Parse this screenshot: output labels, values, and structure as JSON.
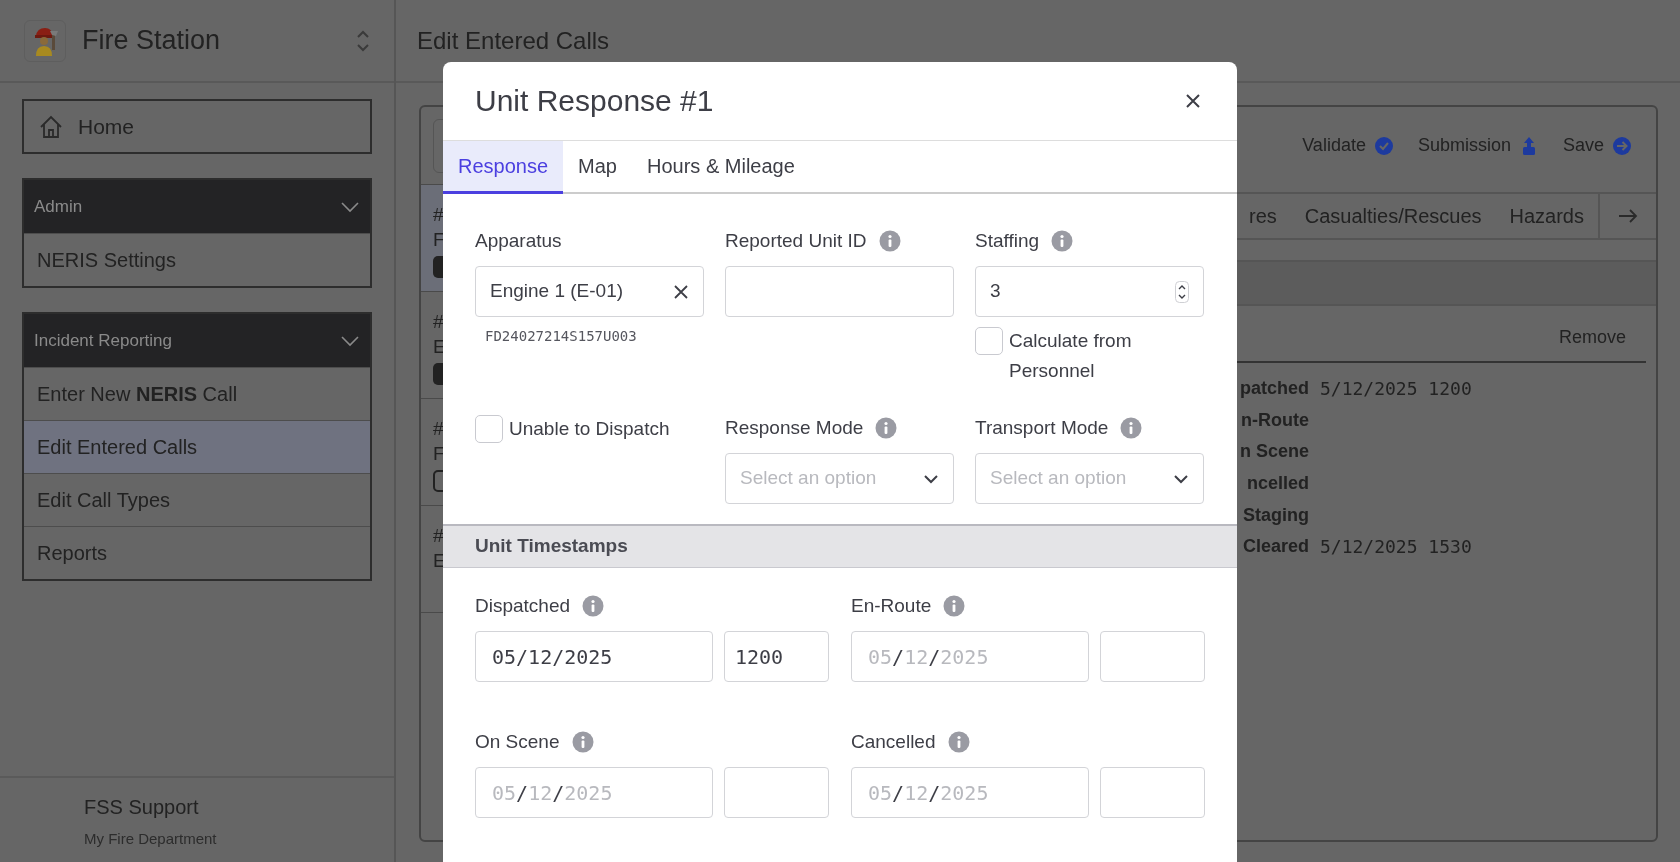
{
  "sidebar": {
    "brand": "Fire Station",
    "home": "Home",
    "groups": [
      {
        "title": "Admin",
        "expanded": true,
        "items": [
          {
            "label": "NERIS Settings",
            "selected": false
          }
        ]
      },
      {
        "title": "Incident Reporting",
        "expanded": true,
        "items": [
          {
            "label": "Enter New **NERIS** Call",
            "selected": false
          },
          {
            "label": "Edit Entered Calls",
            "selected": true
          },
          {
            "label": "Edit Call Types",
            "selected": false
          },
          {
            "label": "Reports",
            "selected": false
          }
        ]
      }
    ],
    "footer": {
      "name": "FSS Support",
      "org": "My Fire Department"
    }
  },
  "page": {
    "title": "Edit Entered Calls",
    "actions": [
      {
        "label": "Validate",
        "kind": "validate"
      },
      {
        "label": "Submission",
        "kind": "submit"
      },
      {
        "label": "Save",
        "kind": "save"
      }
    ],
    "calls": [
      {
        "number": "#",
        "type": "F",
        "badge": true,
        "badge_filled": true,
        "selected": true
      },
      {
        "number": "#",
        "type": "E",
        "badge": true,
        "badge_filled": true,
        "selected": false
      },
      {
        "number": "#",
        "type": "F",
        "badge": true,
        "badge_filled": false,
        "selected": false
      },
      {
        "number": "#",
        "type": "E",
        "badge": false,
        "selected": false
      }
    ],
    "tabs": [
      {
        "label": "res",
        "selected": false
      },
      {
        "label": "Casualties/Rescues",
        "selected": false
      },
      {
        "label": "Hazards",
        "selected": false
      }
    ],
    "remove": "Remove",
    "timestamps": [
      {
        "label": "patched",
        "value": "5/12/2025 1200"
      },
      {
        "label": "n-Route"
      },
      {
        "label": "n Scene"
      },
      {
        "label": "ncelled"
      },
      {
        "label": "Staging"
      },
      {
        "label": "Cleared",
        "value": "5/12/2025 1530"
      }
    ]
  },
  "modal": {
    "title": "Unit Response #1",
    "tabs": [
      {
        "label": "Response",
        "selected": true
      },
      {
        "label": "Map",
        "selected": false
      },
      {
        "label": "Hours & Mileage",
        "selected": false
      }
    ],
    "fields": [
      {
        "kind": "select",
        "label": "Apparatus",
        "value": "Engine 1 (E-01)",
        "clearable": true,
        "note": "FD24027214S157U003"
      },
      {
        "kind": "text",
        "label": "Reported Unit ID",
        "info": true
      },
      {
        "kind": "number",
        "label": "Staffing",
        "info": true,
        "value": "3",
        "checkbox": {
          "label": "Calculate from Personnel",
          "checked": false
        }
      },
      {
        "kind": "check",
        "label": "Unable to Dispatch",
        "checked": false
      },
      {
        "kind": "dropdown",
        "label": "Response Mode",
        "info": true,
        "placeholder": "Select an option"
      },
      {
        "kind": "dropdown",
        "label": "Transport Mode",
        "info": true,
        "placeholder": "Select an option"
      }
    ],
    "section": "Unit Timestamps",
    "timestamps": [
      {
        "label": "Dispatched",
        "info": true,
        "date": "05/12/2025",
        "time": "1200"
      },
      {
        "label": "En-Route",
        "info": true,
        "date_placeholder": "05/12/2025"
      },
      {
        "label": "On Scene",
        "info": true,
        "date_placeholder": "05/12/2025"
      },
      {
        "label": "Cancelled",
        "info": true,
        "date_placeholder": "05/12/2025"
      }
    ]
  }
}
